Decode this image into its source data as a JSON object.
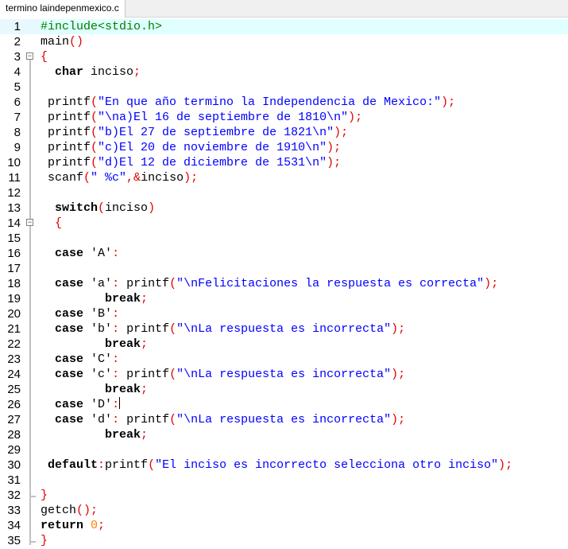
{
  "tab": {
    "title": "termino laindepenmexico.c"
  },
  "editor": {
    "lines": [
      {
        "n": "1",
        "fold": "",
        "tokens": [
          {
            "t": "#include<stdio.h>",
            "c": "pp"
          }
        ],
        "hl": true
      },
      {
        "n": "2",
        "fold": "",
        "tokens": [
          {
            "t": "main",
            "c": "txt"
          },
          {
            "t": "()",
            "c": "op"
          }
        ]
      },
      {
        "n": "3",
        "fold": "open",
        "tokens": [
          {
            "t": "{",
            "c": "op"
          }
        ]
      },
      {
        "n": "4",
        "fold": "",
        "tokens": [
          {
            "t": "  ",
            "c": "txt"
          },
          {
            "t": "char",
            "c": "kw"
          },
          {
            "t": " inciso",
            "c": "txt"
          },
          {
            "t": ";",
            "c": "op"
          }
        ]
      },
      {
        "n": "5",
        "fold": "",
        "tokens": []
      },
      {
        "n": "6",
        "fold": "",
        "tokens": [
          {
            "t": " printf",
            "c": "txt"
          },
          {
            "t": "(",
            "c": "op"
          },
          {
            "t": "\"En que año termino la Independencia de Mexico:\"",
            "c": "str"
          },
          {
            "t": ");",
            "c": "op"
          }
        ]
      },
      {
        "n": "7",
        "fold": "",
        "tokens": [
          {
            "t": " printf",
            "c": "txt"
          },
          {
            "t": "(",
            "c": "op"
          },
          {
            "t": "\"\\na)El 16 de septiembre de 1810\\n\"",
            "c": "str"
          },
          {
            "t": ");",
            "c": "op"
          }
        ]
      },
      {
        "n": "8",
        "fold": "",
        "tokens": [
          {
            "t": " printf",
            "c": "txt"
          },
          {
            "t": "(",
            "c": "op"
          },
          {
            "t": "\"b)El 27 de septiembre de 1821\\n\"",
            "c": "str"
          },
          {
            "t": ");",
            "c": "op"
          }
        ]
      },
      {
        "n": "9",
        "fold": "",
        "tokens": [
          {
            "t": " printf",
            "c": "txt"
          },
          {
            "t": "(",
            "c": "op"
          },
          {
            "t": "\"c)El 20 de noviembre de 1910\\n\"",
            "c": "str"
          },
          {
            "t": ");",
            "c": "op"
          }
        ]
      },
      {
        "n": "10",
        "fold": "",
        "tokens": [
          {
            "t": " printf",
            "c": "txt"
          },
          {
            "t": "(",
            "c": "op"
          },
          {
            "t": "\"d)El 12 de diciembre de 1531\\n\"",
            "c": "str"
          },
          {
            "t": ");",
            "c": "op"
          }
        ]
      },
      {
        "n": "11",
        "fold": "",
        "tokens": [
          {
            "t": " scanf",
            "c": "txt"
          },
          {
            "t": "(",
            "c": "op"
          },
          {
            "t": "\" %c\"",
            "c": "str"
          },
          {
            "t": ",&",
            "c": "op"
          },
          {
            "t": "inciso",
            "c": "txt"
          },
          {
            "t": ");",
            "c": "op"
          }
        ]
      },
      {
        "n": "12",
        "fold": "",
        "tokens": []
      },
      {
        "n": "13",
        "fold": "",
        "tokens": [
          {
            "t": "  ",
            "c": "txt"
          },
          {
            "t": "switch",
            "c": "kw"
          },
          {
            "t": "(",
            "c": "op"
          },
          {
            "t": "inciso",
            "c": "txt"
          },
          {
            "t": ")",
            "c": "op"
          }
        ]
      },
      {
        "n": "14",
        "fold": "open",
        "tokens": [
          {
            "t": "  ",
            "c": "txt"
          },
          {
            "t": "{",
            "c": "op"
          }
        ]
      },
      {
        "n": "15",
        "fold": "",
        "tokens": []
      },
      {
        "n": "16",
        "fold": "",
        "tokens": [
          {
            "t": "  ",
            "c": "txt"
          },
          {
            "t": "case",
            "c": "kw"
          },
          {
            "t": " ",
            "c": "txt"
          },
          {
            "t": "'A'",
            "c": "txt"
          },
          {
            "t": ":",
            "c": "op"
          }
        ]
      },
      {
        "n": "17",
        "fold": "",
        "tokens": []
      },
      {
        "n": "18",
        "fold": "",
        "tokens": [
          {
            "t": "  ",
            "c": "txt"
          },
          {
            "t": "case",
            "c": "kw"
          },
          {
            "t": " ",
            "c": "txt"
          },
          {
            "t": "'a'",
            "c": "txt"
          },
          {
            "t": ":",
            "c": "op"
          },
          {
            "t": " printf",
            "c": "txt"
          },
          {
            "t": "(",
            "c": "op"
          },
          {
            "t": "\"\\nFelicitaciones la respuesta es correcta\"",
            "c": "str"
          },
          {
            "t": ");",
            "c": "op"
          }
        ]
      },
      {
        "n": "19",
        "fold": "",
        "tokens": [
          {
            "t": "         ",
            "c": "txt"
          },
          {
            "t": "break",
            "c": "kw"
          },
          {
            "t": ";",
            "c": "op"
          }
        ]
      },
      {
        "n": "20",
        "fold": "",
        "tokens": [
          {
            "t": "  ",
            "c": "txt"
          },
          {
            "t": "case",
            "c": "kw"
          },
          {
            "t": " ",
            "c": "txt"
          },
          {
            "t": "'B'",
            "c": "txt"
          },
          {
            "t": ":",
            "c": "op"
          }
        ]
      },
      {
        "n": "21",
        "fold": "",
        "tokens": [
          {
            "t": "  ",
            "c": "txt"
          },
          {
            "t": "case",
            "c": "kw"
          },
          {
            "t": " ",
            "c": "txt"
          },
          {
            "t": "'b'",
            "c": "txt"
          },
          {
            "t": ":",
            "c": "op"
          },
          {
            "t": " printf",
            "c": "txt"
          },
          {
            "t": "(",
            "c": "op"
          },
          {
            "t": "\"\\nLa respuesta es incorrecta\"",
            "c": "str"
          },
          {
            "t": ");",
            "c": "op"
          }
        ]
      },
      {
        "n": "22",
        "fold": "",
        "tokens": [
          {
            "t": "         ",
            "c": "txt"
          },
          {
            "t": "break",
            "c": "kw"
          },
          {
            "t": ";",
            "c": "op"
          }
        ]
      },
      {
        "n": "23",
        "fold": "",
        "tokens": [
          {
            "t": "  ",
            "c": "txt"
          },
          {
            "t": "case",
            "c": "kw"
          },
          {
            "t": " ",
            "c": "txt"
          },
          {
            "t": "'C'",
            "c": "txt"
          },
          {
            "t": ":",
            "c": "op"
          }
        ]
      },
      {
        "n": "24",
        "fold": "",
        "tokens": [
          {
            "t": "  ",
            "c": "txt"
          },
          {
            "t": "case",
            "c": "kw"
          },
          {
            "t": " ",
            "c": "txt"
          },
          {
            "t": "'c'",
            "c": "txt"
          },
          {
            "t": ":",
            "c": "op"
          },
          {
            "t": " printf",
            "c": "txt"
          },
          {
            "t": "(",
            "c": "op"
          },
          {
            "t": "\"\\nLa respuesta es incorrecta\"",
            "c": "str"
          },
          {
            "t": ");",
            "c": "op"
          }
        ]
      },
      {
        "n": "25",
        "fold": "",
        "tokens": [
          {
            "t": "         ",
            "c": "txt"
          },
          {
            "t": "break",
            "c": "kw"
          },
          {
            "t": ";",
            "c": "op"
          }
        ]
      },
      {
        "n": "26",
        "fold": "",
        "tokens": [
          {
            "t": "  ",
            "c": "txt"
          },
          {
            "t": "case",
            "c": "kw"
          },
          {
            "t": " ",
            "c": "txt"
          },
          {
            "t": "'D'",
            "c": "txt"
          },
          {
            "t": ":",
            "c": "op"
          },
          {
            "t": "|",
            "c": "caret"
          }
        ]
      },
      {
        "n": "27",
        "fold": "",
        "tokens": [
          {
            "t": "  ",
            "c": "txt"
          },
          {
            "t": "case",
            "c": "kw"
          },
          {
            "t": " ",
            "c": "txt"
          },
          {
            "t": "'d'",
            "c": "txt"
          },
          {
            "t": ":",
            "c": "op"
          },
          {
            "t": " printf",
            "c": "txt"
          },
          {
            "t": "(",
            "c": "op"
          },
          {
            "t": "\"\\nLa respuesta es incorrecta\"",
            "c": "str"
          },
          {
            "t": ");",
            "c": "op"
          }
        ]
      },
      {
        "n": "28",
        "fold": "",
        "tokens": [
          {
            "t": "         ",
            "c": "txt"
          },
          {
            "t": "break",
            "c": "kw"
          },
          {
            "t": ";",
            "c": "op"
          }
        ]
      },
      {
        "n": "29",
        "fold": "",
        "tokens": []
      },
      {
        "n": "30",
        "fold": "",
        "tokens": [
          {
            "t": " ",
            "c": "txt"
          },
          {
            "t": "default",
            "c": "kw"
          },
          {
            "t": ":",
            "c": "op"
          },
          {
            "t": "printf",
            "c": "txt"
          },
          {
            "t": "(",
            "c": "op"
          },
          {
            "t": "\"El inciso es incorrecto selecciona otro inciso\"",
            "c": "str"
          },
          {
            "t": ");",
            "c": "op"
          }
        ]
      },
      {
        "n": "31",
        "fold": "",
        "tokens": []
      },
      {
        "n": "32",
        "fold": "end",
        "tokens": [
          {
            "t": "}",
            "c": "op"
          }
        ]
      },
      {
        "n": "33",
        "fold": "",
        "tokens": [
          {
            "t": "getch",
            "c": "txt"
          },
          {
            "t": "();",
            "c": "op"
          }
        ]
      },
      {
        "n": "34",
        "fold": "",
        "tokens": [
          {
            "t": "return",
            "c": "kw"
          },
          {
            "t": " ",
            "c": "txt"
          },
          {
            "t": "0",
            "c": "num"
          },
          {
            "t": ";",
            "c": "op"
          }
        ]
      },
      {
        "n": "35",
        "fold": "end",
        "tokens": [
          {
            "t": "}",
            "c": "op"
          }
        ]
      }
    ]
  },
  "colors": {
    "preprocessor": "#008000",
    "string": "#0000ff",
    "operator": "#e00000",
    "number": "#ff8000",
    "current_line": "#e0ffff"
  }
}
